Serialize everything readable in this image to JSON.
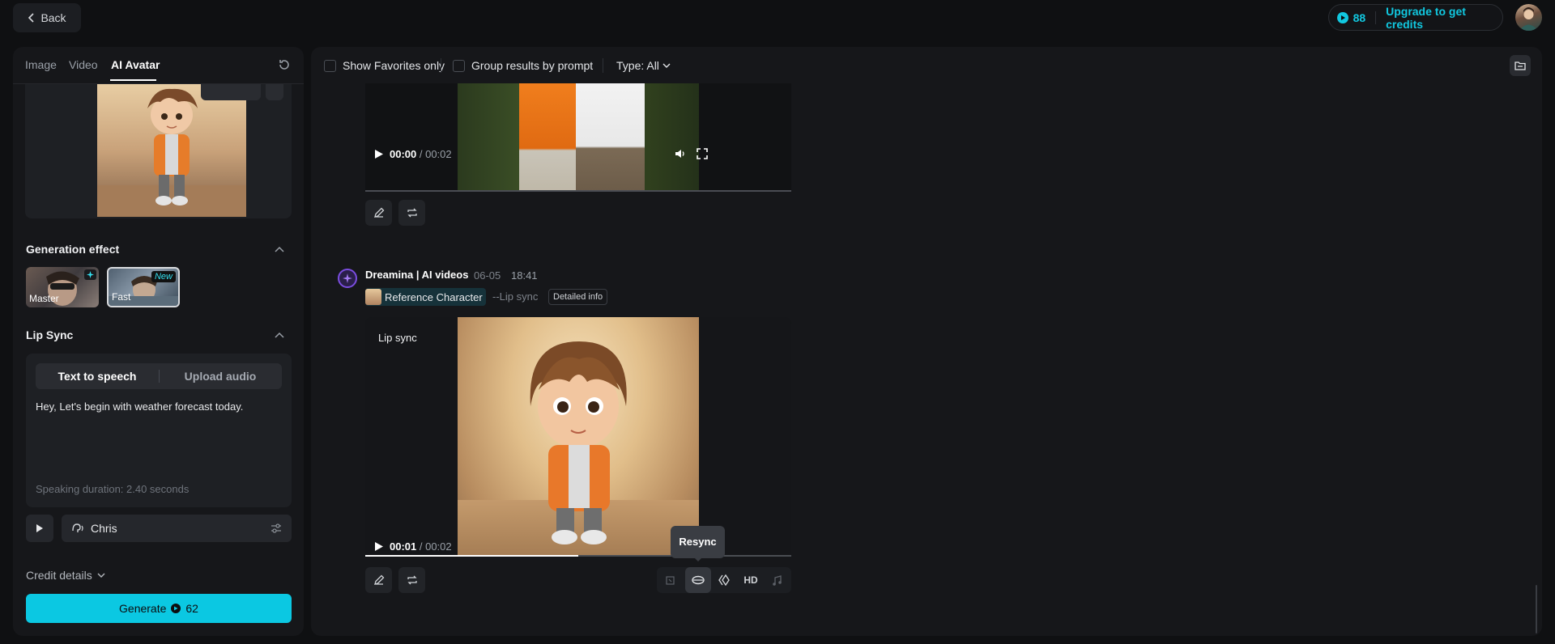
{
  "topbar": {
    "back_label": "Back",
    "credits": "88",
    "upgrade_label": "Upgrade to get credits"
  },
  "left": {
    "tabs": [
      {
        "label": "Image"
      },
      {
        "label": "Video"
      },
      {
        "label": "AI Avatar"
      }
    ],
    "generation_effect": {
      "title": "Generation effect",
      "options": [
        {
          "label": "Master"
        },
        {
          "label": "Fast",
          "badge": "New"
        }
      ]
    },
    "lip_sync": {
      "title": "Lip Sync",
      "modes": [
        "Text to speech",
        "Upload audio"
      ],
      "text": "Hey, Let's begin with weather forecast today.",
      "duration": "Speaking duration: 2.40 seconds",
      "voice": "Chris"
    },
    "credit_details": "Credit details",
    "generate": {
      "label": "Generate",
      "cost": "62"
    }
  },
  "main": {
    "filters": {
      "favorites": "Show Favorites only",
      "group": "Group results by prompt",
      "type": "Type: All"
    },
    "video1": {
      "current": "00:00",
      "total": " / 00:02"
    },
    "result": {
      "title": "Dreamina | AI videos",
      "date": "06-05",
      "time": "18:41",
      "reference": "Reference Character",
      "tag": "--Lip sync",
      "detail": "Detailed info",
      "overlay": "Lip sync",
      "current": "00:01",
      "total": " / 00:02",
      "tooltip": "Resync",
      "hd": "HD"
    }
  }
}
